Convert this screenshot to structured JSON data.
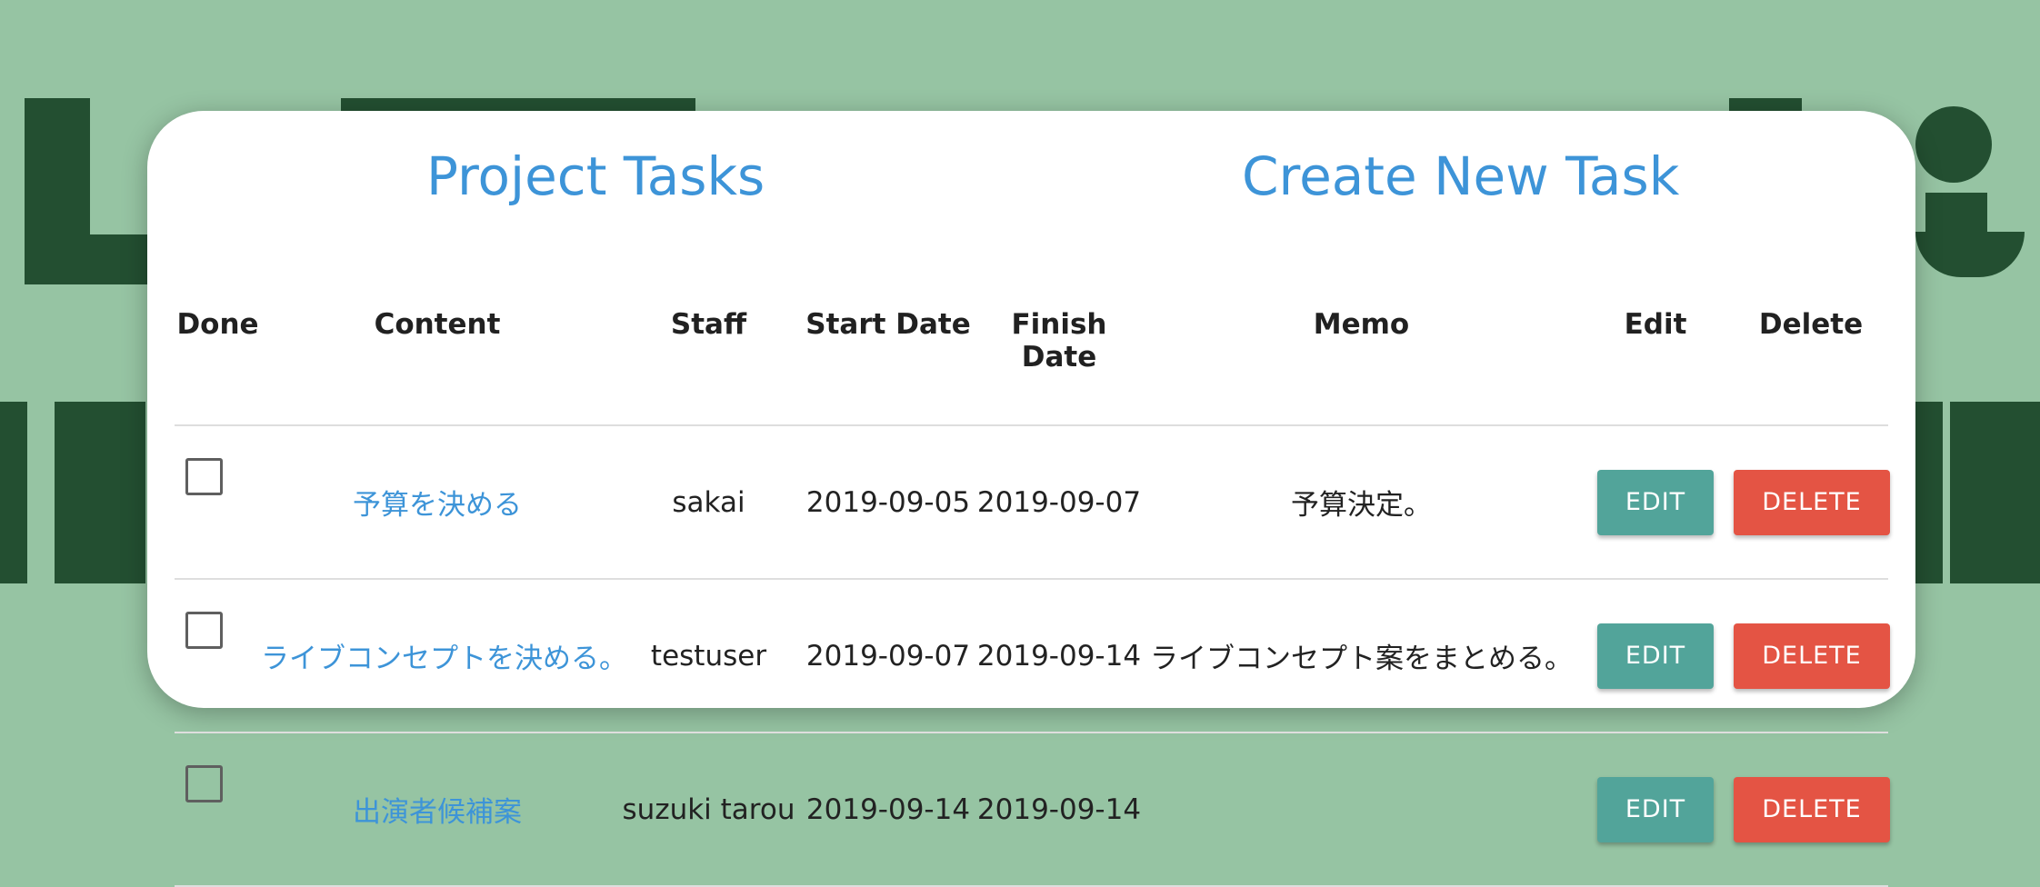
{
  "headings": {
    "project_tasks": "Project Tasks",
    "create_new_task": "Create New Task"
  },
  "table": {
    "columns": [
      "Done",
      "Content",
      "Staff",
      "Start Date",
      "Finish Date",
      "Memo",
      "Edit",
      "Delete"
    ],
    "rows": [
      {
        "done": false,
        "content": "予算を決める",
        "staff": "sakai",
        "start_date": "2019-09-05",
        "finish_date": "2019-09-07",
        "memo": "予算決定。",
        "edit_label": "EDIT",
        "delete_label": "DELETE"
      },
      {
        "done": false,
        "content": "ライブコンセプトを決める。",
        "staff": "testuser",
        "start_date": "2019-09-07",
        "finish_date": "2019-09-14",
        "memo": "ライブコンセプト案をまとめる。",
        "edit_label": "EDIT",
        "delete_label": "DELETE"
      },
      {
        "done": false,
        "content": "出演者候補案",
        "staff": "suzuki tarou",
        "start_date": "2019-09-14",
        "finish_date": "2019-09-14",
        "memo": "",
        "edit_label": "EDIT",
        "delete_label": "DELETE"
      }
    ]
  },
  "colors": {
    "background": "#96c4a3",
    "background_art": "#234f31",
    "link": "#3d94d8",
    "edit_button": "#52a49a",
    "delete_button": "#e45444"
  }
}
